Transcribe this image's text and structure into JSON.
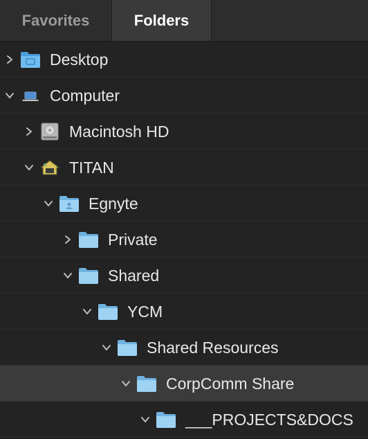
{
  "tabs": [
    {
      "label": "Favorites",
      "selected": false
    },
    {
      "label": "Folders",
      "selected": true
    }
  ],
  "tree": [
    {
      "label": "Desktop",
      "level": 0,
      "expanded": false,
      "icon": "desktop-folder-icon"
    },
    {
      "label": "Computer",
      "level": 0,
      "expanded": true,
      "icon": "laptop-icon"
    },
    {
      "label": "Macintosh HD",
      "level": 1,
      "expanded": false,
      "icon": "hard-drive-icon"
    },
    {
      "label": "TITAN",
      "level": 1,
      "expanded": true,
      "icon": "network-server-icon"
    },
    {
      "label": "Egnyte",
      "level": 2,
      "expanded": true,
      "icon": "shared-folder-icon"
    },
    {
      "label": "Private",
      "level": 3,
      "expanded": false,
      "icon": "folder-icon"
    },
    {
      "label": "Shared",
      "level": 3,
      "expanded": true,
      "icon": "folder-icon"
    },
    {
      "label": "YCM",
      "level": 4,
      "expanded": true,
      "icon": "folder-icon"
    },
    {
      "label": "Shared Resources",
      "level": 5,
      "expanded": true,
      "icon": "folder-icon"
    },
    {
      "label": "CorpComm Share",
      "level": 6,
      "expanded": true,
      "icon": "folder-icon",
      "selected": true
    },
    {
      "label": "___PROJECTS&DOCS",
      "level": 7,
      "expanded": true,
      "icon": "folder-icon"
    }
  ],
  "colors": {
    "background": "#232323",
    "tabbar": "#2d2d2d",
    "selected_tab": "#3a3a3a",
    "selected_row": "#3b3b3b",
    "folder_blue": "#8fc9ee"
  }
}
